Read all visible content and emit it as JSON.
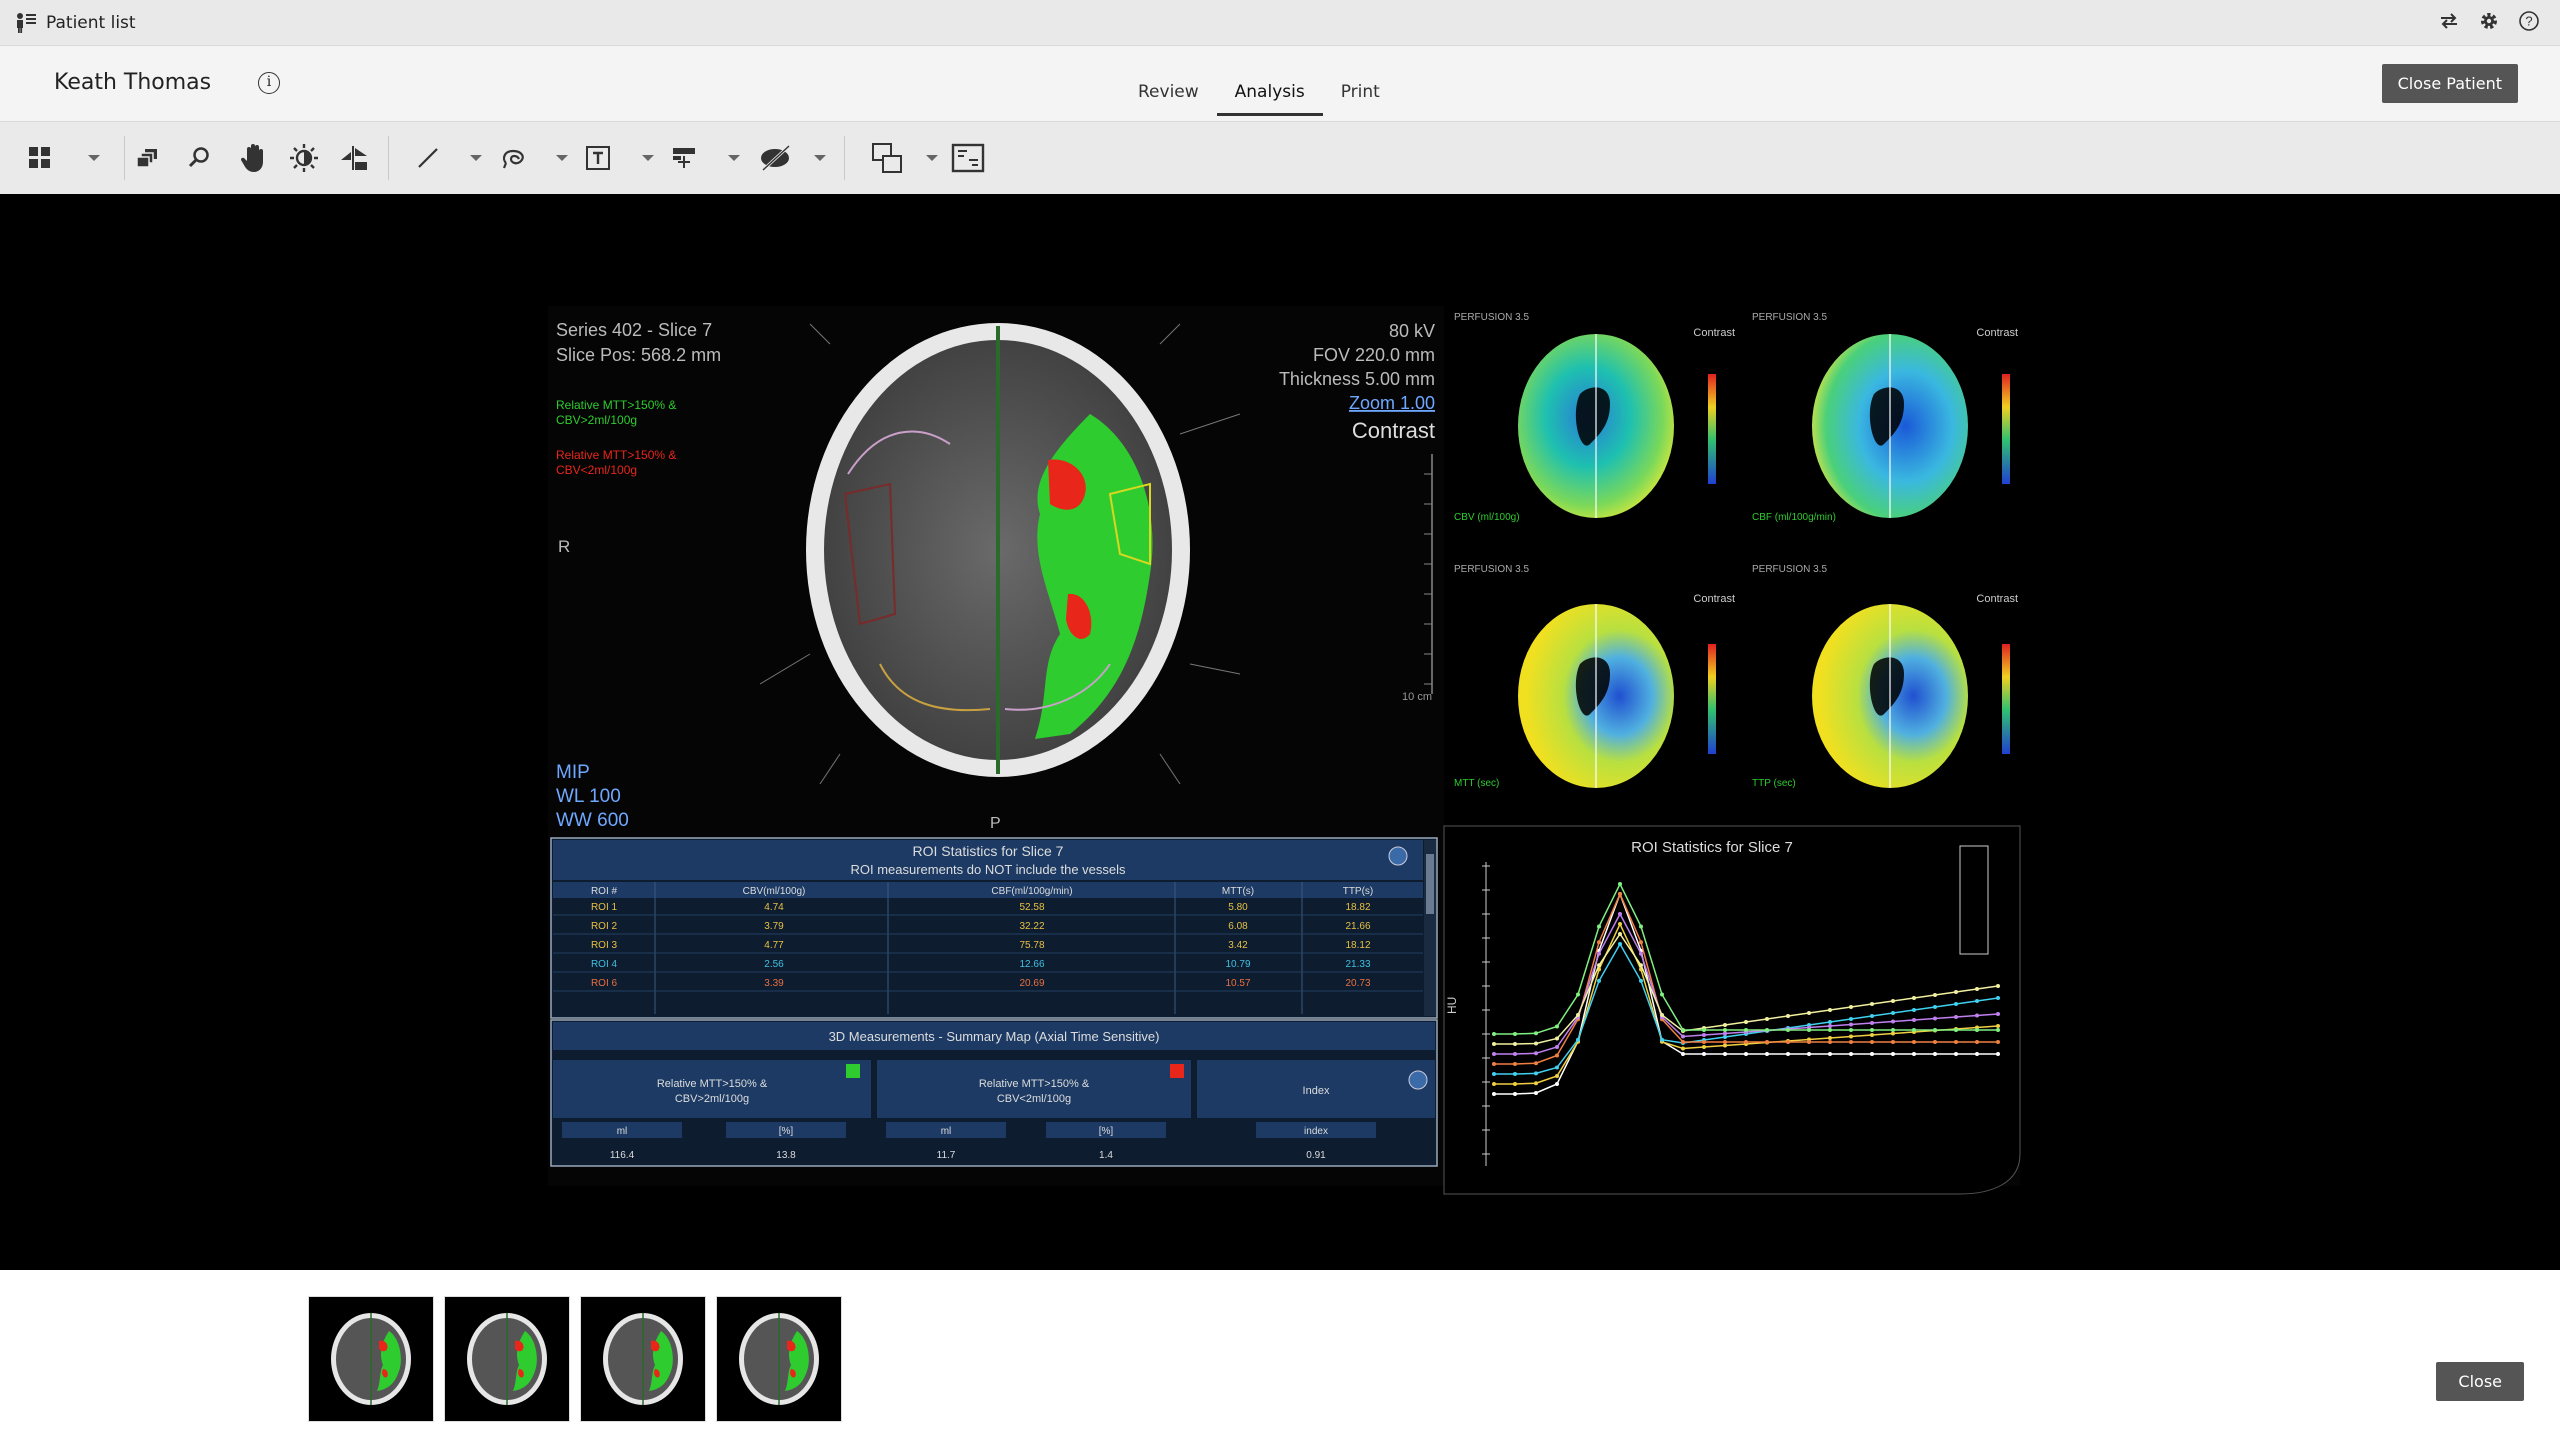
{
  "topbar": {
    "patient_list_label": "Patient list"
  },
  "header": {
    "patient_name": "Keath Thomas",
    "tabs": [
      {
        "label": "Review"
      },
      {
        "label": "Analysis"
      },
      {
        "label": "Print"
      }
    ],
    "active_tab": "Analysis",
    "close_patient_label": "Close Patient"
  },
  "toolbar": {
    "tools": [
      "layout-grid",
      "stack",
      "zoom",
      "pan",
      "window-level",
      "flip",
      "line-measure",
      "roi",
      "text-annotation",
      "marker",
      "hide-overlays",
      "compare",
      "image-info"
    ]
  },
  "viewer": {
    "series_line": "Series 402 - Slice 7",
    "slice_pos": "Slice Pos: 568.2 mm",
    "legend_green": "Relative MTT>150% &",
    "legend_green2": "CBV>2ml/100g",
    "legend_red": "Relative MTT>150% &",
    "legend_red2": "CBV<2ml/100g",
    "kv": "80 kV",
    "fov": "FOV 220.0 mm",
    "thickness": "Thickness 5.00 mm",
    "zoom": "Zoom 1.00",
    "contrast": "Contrast",
    "orient_r": "R",
    "orient_p": "P",
    "scale": "10 cm",
    "mip": "MIP",
    "wl": "WL   100",
    "ww": "WW   600",
    "map_labels": [
      "CBV (ml/100g)",
      "CBF (ml/100g/min)",
      "MTT (sec)",
      "TTP (sec)"
    ],
    "roi_table": {
      "title": "ROI Statistics for Slice 7",
      "subtitle": "ROI measurements do NOT include the vessels",
      "headers": [
        "ROI #",
        "CBV(ml/100g)",
        "CBF(ml/100g/min)",
        "MTT(s)",
        "TTP(s)"
      ],
      "rows": [
        [
          "ROI 1",
          "4.74",
          "52.58",
          "5.80",
          "18.82"
        ],
        [
          "ROI 2",
          "3.79",
          "32.22",
          "6.08",
          "21.66"
        ],
        [
          "ROI 3",
          "4.77",
          "75.78",
          "3.42",
          "18.12"
        ],
        [
          "ROI 4",
          "2.56",
          "12.66",
          "10.79",
          "21.33"
        ],
        [
          "ROI 6",
          "3.39",
          "20.69",
          "10.57",
          "20.73"
        ]
      ]
    },
    "summary": {
      "title": "3D Measurements - Summary Map (Axial Time Sensitive)",
      "col1": "Relative MTT>150% &",
      "col1b": "CBV>2ml/100g",
      "col2": "Relative MTT>150% &",
      "col2b": "CBV<2ml/100g",
      "col3": "Index",
      "units": [
        "ml",
        "[%]",
        "ml",
        "[%]",
        "index"
      ],
      "values": [
        "116.4",
        "13.8",
        "11.7",
        "1.4",
        "0.91"
      ]
    },
    "chart_title": "ROI Statistics for Slice 7",
    "chart_ylabel": "HU"
  },
  "thumbnails": {
    "count": 4
  },
  "footer": {
    "close_label": "Close"
  },
  "colors": {
    "green": "#2ecc2e",
    "red": "#e8261a",
    "panel_blue": "#1c3a63"
  }
}
